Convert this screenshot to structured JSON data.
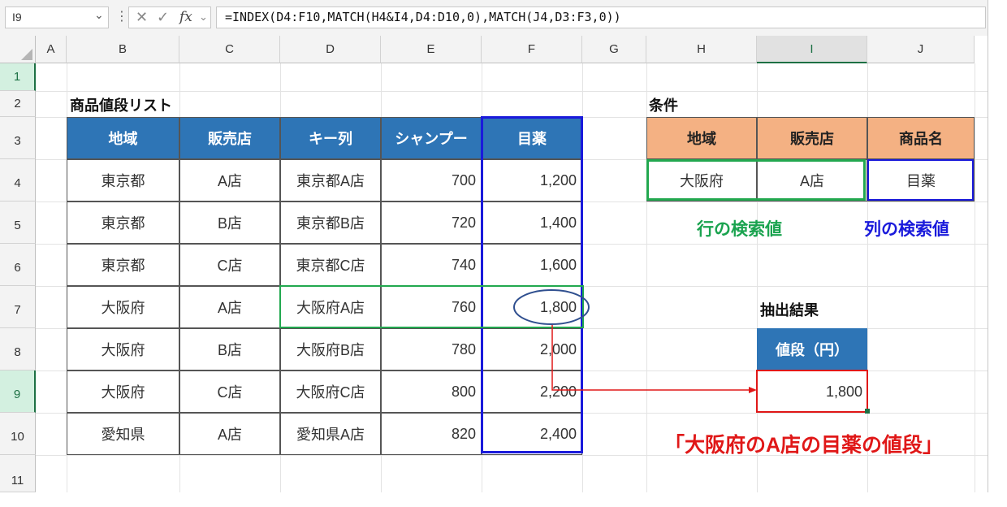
{
  "formula_bar": {
    "name_box": "I9",
    "formula": "=INDEX(D4:F10,MATCH(H4&I4,D4:D10,0),MATCH(J4,D3:F3,0))",
    "fx_label": "fx"
  },
  "columns": [
    "A",
    "B",
    "C",
    "D",
    "E",
    "F",
    "G",
    "H",
    "I",
    "J"
  ],
  "rows": [
    "1",
    "2",
    "3",
    "4",
    "5",
    "6",
    "7",
    "8",
    "9",
    "10",
    "11"
  ],
  "selected_cell": "I9",
  "list_table": {
    "title": "商品値段リスト",
    "headers": [
      "地域",
      "販売店",
      "キー列",
      "シャンプー",
      "目薬"
    ],
    "rows": [
      [
        "東京都",
        "A店",
        "東京都A店",
        "700",
        "1,200"
      ],
      [
        "東京都",
        "B店",
        "東京都B店",
        "720",
        "1,400"
      ],
      [
        "東京都",
        "C店",
        "東京都C店",
        "740",
        "1,600"
      ],
      [
        "大阪府",
        "A店",
        "大阪府A店",
        "760",
        "1,800"
      ],
      [
        "大阪府",
        "B店",
        "大阪府B店",
        "780",
        "2,000"
      ],
      [
        "大阪府",
        "C店",
        "大阪府C店",
        "800",
        "2,200"
      ],
      [
        "愛知県",
        "A店",
        "愛知県A店",
        "820",
        "2,400"
      ]
    ]
  },
  "condition_table": {
    "title": "条件",
    "headers": [
      "地域",
      "販売店",
      "商品名"
    ],
    "values": [
      "大阪府",
      "A店",
      "目薬"
    ]
  },
  "annotations": {
    "row_lookup": "行の検索値",
    "col_lookup": "列の検索値",
    "caption": "「大阪府のA店の目薬の値段」"
  },
  "result": {
    "title": "抽出結果",
    "header": "値段（円）",
    "value": "1,800"
  },
  "colors": {
    "header_blue": "#2e75b6",
    "header_orange": "#f4b183",
    "highlight_blue": "#1a1adb",
    "highlight_green": "#22a84f",
    "highlight_red": "#e01818",
    "excel_green": "#1d7044"
  }
}
